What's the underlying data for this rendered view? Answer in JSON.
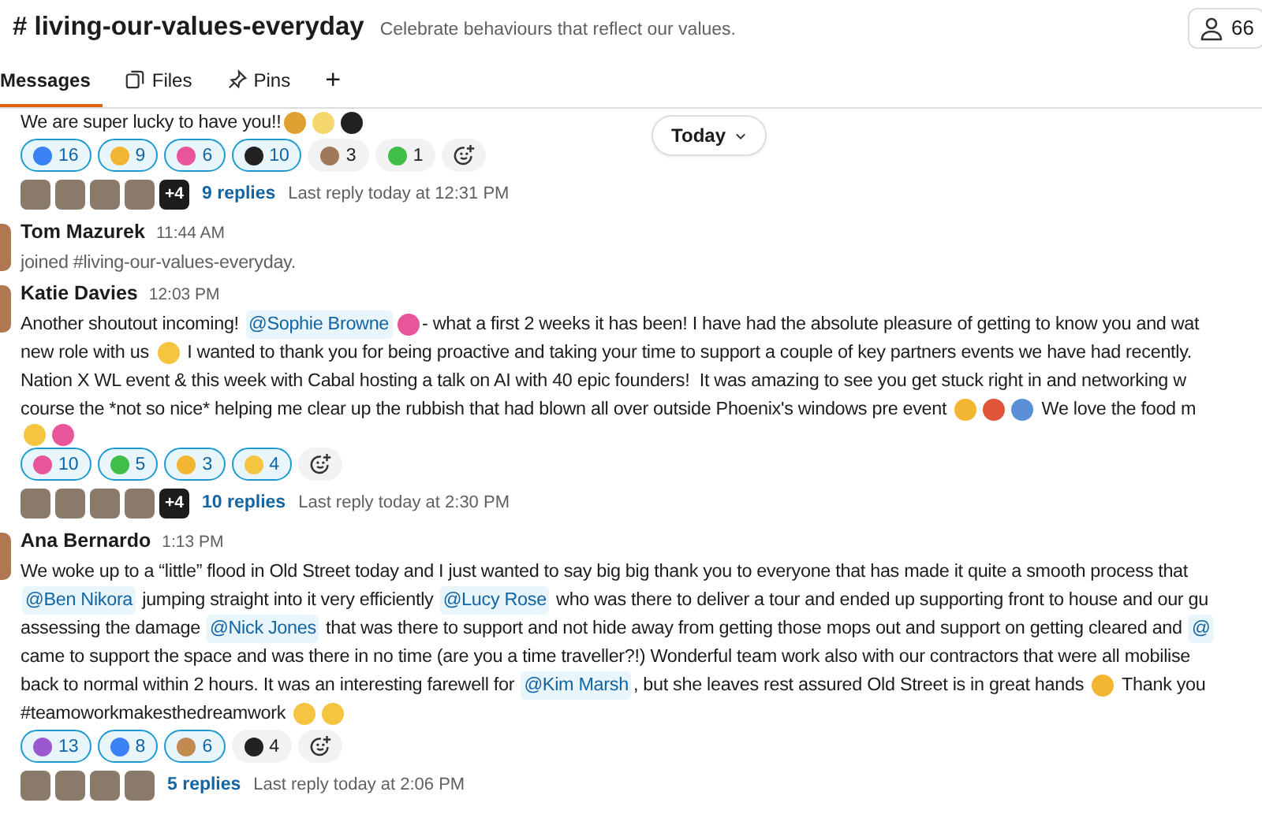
{
  "channel": {
    "name": "# living-our-values-everyday",
    "description": "Celebrate behaviours that reflect our values.",
    "member_count": "66"
  },
  "tabs": [
    {
      "label": "Messages",
      "selected": true,
      "kind": "messages"
    },
    {
      "label": "Files",
      "selected": false,
      "kind": "files"
    },
    {
      "label": "Pins",
      "selected": false,
      "kind": "pins"
    },
    {
      "label": "+",
      "selected": false,
      "kind": "add"
    }
  ],
  "date_divider": "Today",
  "messages": [
    {
      "kind": "continuation",
      "lines": [
        [
          {
            "kind": "text",
            "text": "We are super lucky to have you!!"
          },
          {
            "kind": "emoji",
            "color": "#e0a030"
          },
          {
            "kind": "emoji",
            "color": "#f5d76e"
          },
          {
            "kind": "emoji",
            "color": "#222222"
          }
        ]
      ],
      "reactions": [
        {
          "color": "#3b82f6",
          "count": "16",
          "selected": true
        },
        {
          "color": "#f2b632",
          "count": "9",
          "selected": true
        },
        {
          "color": "#e8559a",
          "count": "6",
          "selected": true
        },
        {
          "color": "#222222",
          "count": "10",
          "selected": true
        },
        {
          "color": "#a0785a",
          "count": "3",
          "selected": false
        },
        {
          "color": "#3fbf4a",
          "count": "1",
          "selected": false
        }
      ],
      "replies": {
        "more": "+4",
        "count": "9 replies",
        "last": "Last reply today at 12:31 PM"
      }
    },
    {
      "kind": "join",
      "author": "Tom Mazurek",
      "time": "11:44 AM",
      "lines": [
        [
          {
            "kind": "text",
            "text": "joined #living-our-values-everyday."
          }
        ]
      ]
    },
    {
      "kind": "message",
      "author": "Katie Davies",
      "time": "12:03 PM",
      "lines": [
        [
          {
            "kind": "text",
            "text": "Another shoutout incoming! "
          },
          {
            "kind": "mention",
            "text": "@Sophie Browne"
          },
          {
            "kind": "emoji",
            "color": "#e8559a"
          },
          {
            "kind": "text",
            "text": "- what a first 2 weeks it has been! I have had the absolute pleasure of getting to know you and wat"
          }
        ],
        [
          {
            "kind": "text",
            "text": "new role with us "
          },
          {
            "kind": "emoji",
            "color": "#f5c542"
          },
          {
            "kind": "text",
            "text": " I wanted to thank you for being proactive and taking your time to support a couple of key partners events we have had recently."
          }
        ],
        [
          {
            "kind": "text",
            "text": "Nation X WL event & this week with Cabal hosting a talk on AI with 40 epic founders!  It was amazing to see you get stuck right in and networking w"
          }
        ],
        [
          {
            "kind": "text",
            "text": "course the *not so nice* helping me clear up the rubbish that had blown all over outside Phoenix's windows pre event "
          },
          {
            "kind": "emoji",
            "color": "#f2b632"
          },
          {
            "kind": "emoji",
            "color": "#e0553a"
          },
          {
            "kind": "emoji",
            "color": "#5b8fd6"
          },
          {
            "kind": "text",
            "text": " We love the food m"
          }
        ],
        [
          {
            "kind": "emoji",
            "color": "#f5c542"
          },
          {
            "kind": "emoji",
            "color": "#e8559a"
          }
        ]
      ],
      "reactions": [
        {
          "color": "#e8559a",
          "count": "10",
          "selected": true
        },
        {
          "color": "#3fbf4a",
          "count": "5",
          "selected": true
        },
        {
          "color": "#f2b632",
          "count": "3",
          "selected": true
        },
        {
          "color": "#f5c542",
          "count": "4",
          "selected": true
        }
      ],
      "replies": {
        "more": "+4",
        "count": "10 replies",
        "last": "Last reply today at 2:30 PM"
      }
    },
    {
      "kind": "message",
      "author": "Ana Bernardo",
      "time": "1:13 PM",
      "lines": [
        [
          {
            "kind": "text",
            "text": "We woke up to a “little” flood in Old Street today and I just wanted to say big big thank you to everyone that has made it quite a smooth process that"
          }
        ],
        [
          {
            "kind": "mention",
            "text": "@Ben Nikora"
          },
          {
            "kind": "text",
            "text": " jumping straight into it very efficiently "
          },
          {
            "kind": "mention",
            "text": "@Lucy Rose"
          },
          {
            "kind": "text",
            "text": " who was there to deliver a tour and ended up supporting front to house and our gu"
          }
        ],
        [
          {
            "kind": "text",
            "text": "assessing the damage "
          },
          {
            "kind": "mention",
            "text": "@Nick Jones"
          },
          {
            "kind": "text",
            "text": " that was there to support and not hide away from getting those mops out and support on getting cleared and "
          },
          {
            "kind": "mention",
            "text": "@"
          }
        ],
        [
          {
            "kind": "text",
            "text": "came to support the space and was there in no time (are you a time traveller?!) Wonderful team work also with our contractors that were all mobilise"
          }
        ],
        [
          {
            "kind": "text",
            "text": "back to normal within 2 hours. It was an interesting farewell for "
          },
          {
            "kind": "mention",
            "text": "@Kim Marsh"
          },
          {
            "kind": "text",
            "text": ", but she leaves rest assured Old Street is in great hands "
          },
          {
            "kind": "emoji",
            "color": "#f2b632"
          },
          {
            "kind": "text",
            "text": " Thank you"
          }
        ],
        [
          {
            "kind": "text",
            "text": "#teamoworkmakesthedreamwork "
          },
          {
            "kind": "emoji",
            "color": "#f5c542"
          },
          {
            "kind": "emoji",
            "color": "#f5c542"
          }
        ]
      ],
      "reactions": [
        {
          "color": "#9b59d0",
          "count": "13",
          "selected": true
        },
        {
          "color": "#3b82f6",
          "count": "8",
          "selected": true
        },
        {
          "color": "#c08a50",
          "count": "6",
          "selected": true
        },
        {
          "color": "#222222",
          "count": "4",
          "selected": false
        }
      ],
      "replies": {
        "count": "5 replies",
        "last": "Last reply today at 2:06 PM"
      }
    }
  ]
}
